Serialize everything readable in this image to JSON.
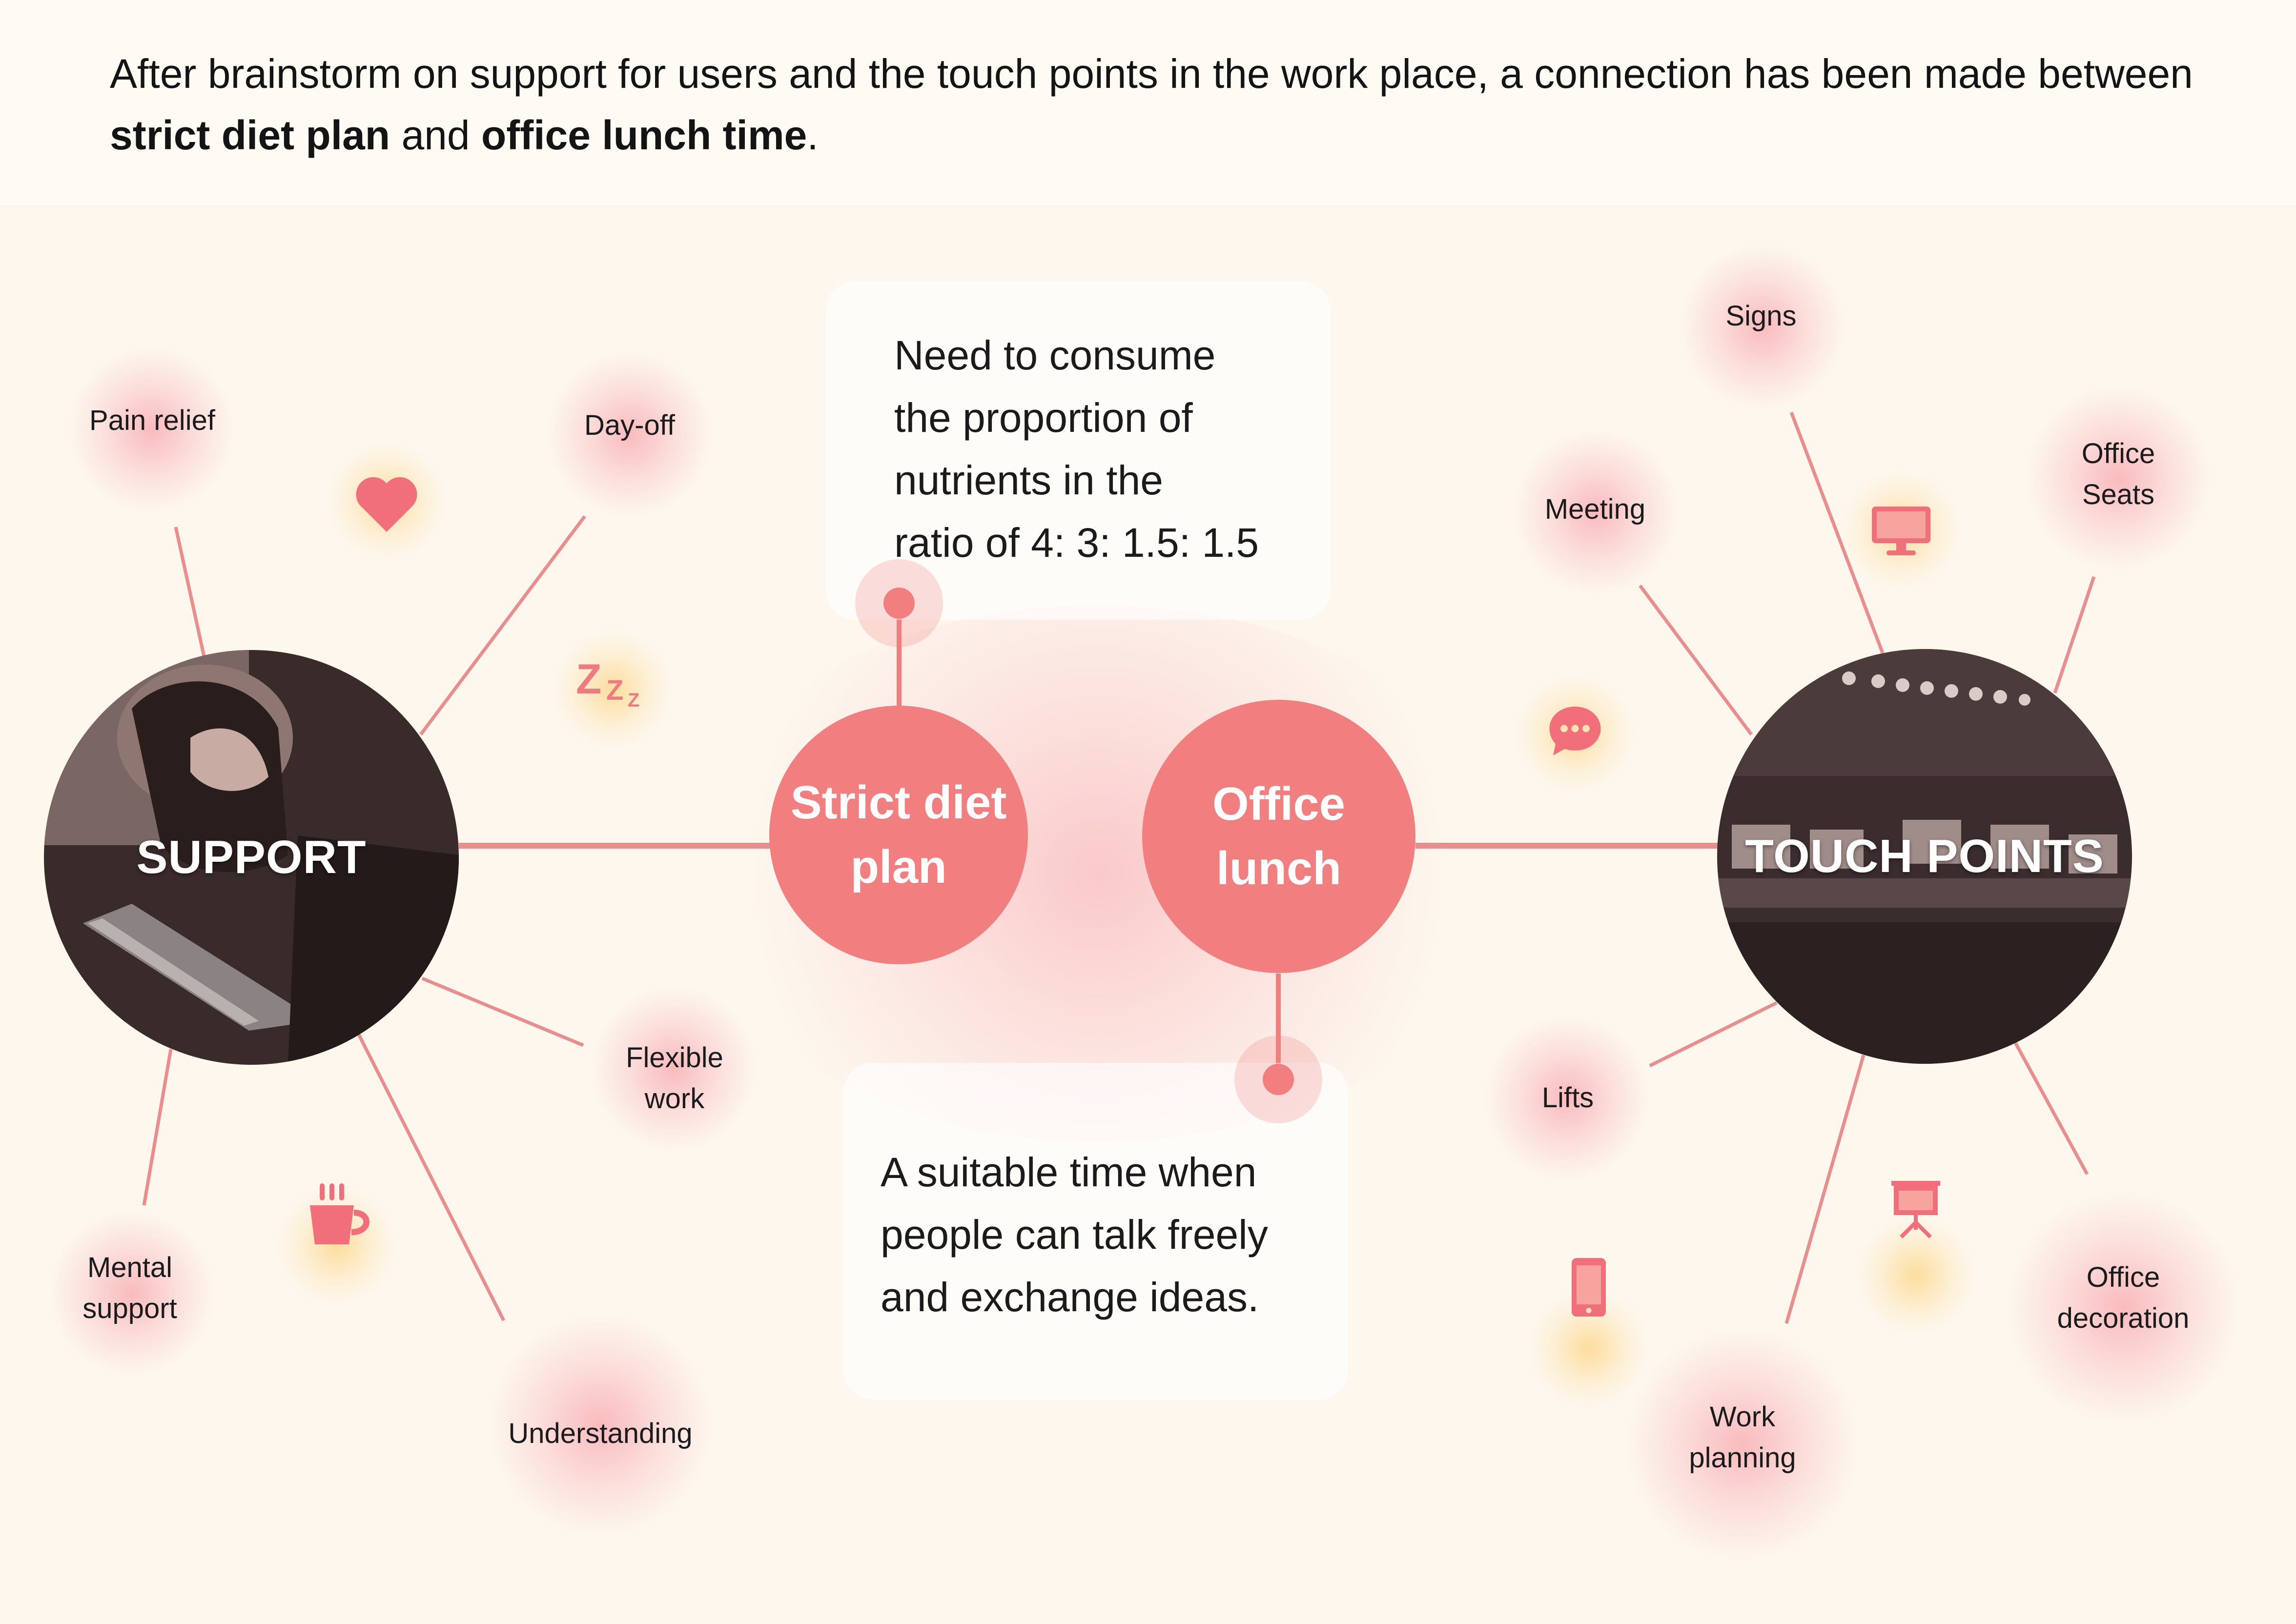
{
  "intro": {
    "part1": "After brainstorm on support for users and the touch points in the work place, a connection has been made between ",
    "bold1": "strict diet plan",
    "part2": " and ",
    "bold2": "office lunch time",
    "part3": "."
  },
  "hubs": {
    "support": "SUPPORT",
    "touch_points": "TOUCH POINTS"
  },
  "core": {
    "diet": "Strict diet\nplan",
    "lunch": "Office\nlunch"
  },
  "cards": {
    "diet_note": [
      "Need to consume",
      "the proportion of",
      "nutrients in the",
      "ratio of 4: 3: 1.5: 1.5"
    ],
    "lunch_note": [
      "A suitable time when",
      "people can talk freely",
      "and exchange ideas."
    ]
  },
  "support_nodes": {
    "pain_relief": "Pain relief",
    "day_off": "Day-off",
    "flexible_work": [
      "Flexible",
      "work"
    ],
    "mental_support": [
      "Mental",
      "support"
    ],
    "understanding": "Understanding"
  },
  "touch_nodes": {
    "signs": "Signs",
    "meeting": "Meeting",
    "office_seats": [
      "Office",
      "Seats"
    ],
    "lifts": "Lifts",
    "work_planning": [
      "Work",
      "planning"
    ],
    "office_decoration": [
      "Office",
      "decoration"
    ]
  },
  "icons": {
    "support": [
      "heart-icon",
      "sleep-zzz-icon",
      "coffee-cup-icon"
    ],
    "touch": [
      "monitor-icon",
      "chat-bubble-icon",
      "presentation-board-icon",
      "smartphone-icon"
    ]
  },
  "colors": {
    "accent": "#f17f7f",
    "line": "#e98d8d",
    "icon_glow": "#fcd482",
    "photo_tint": "#3a2b2b",
    "background": "#fdf7ee"
  }
}
